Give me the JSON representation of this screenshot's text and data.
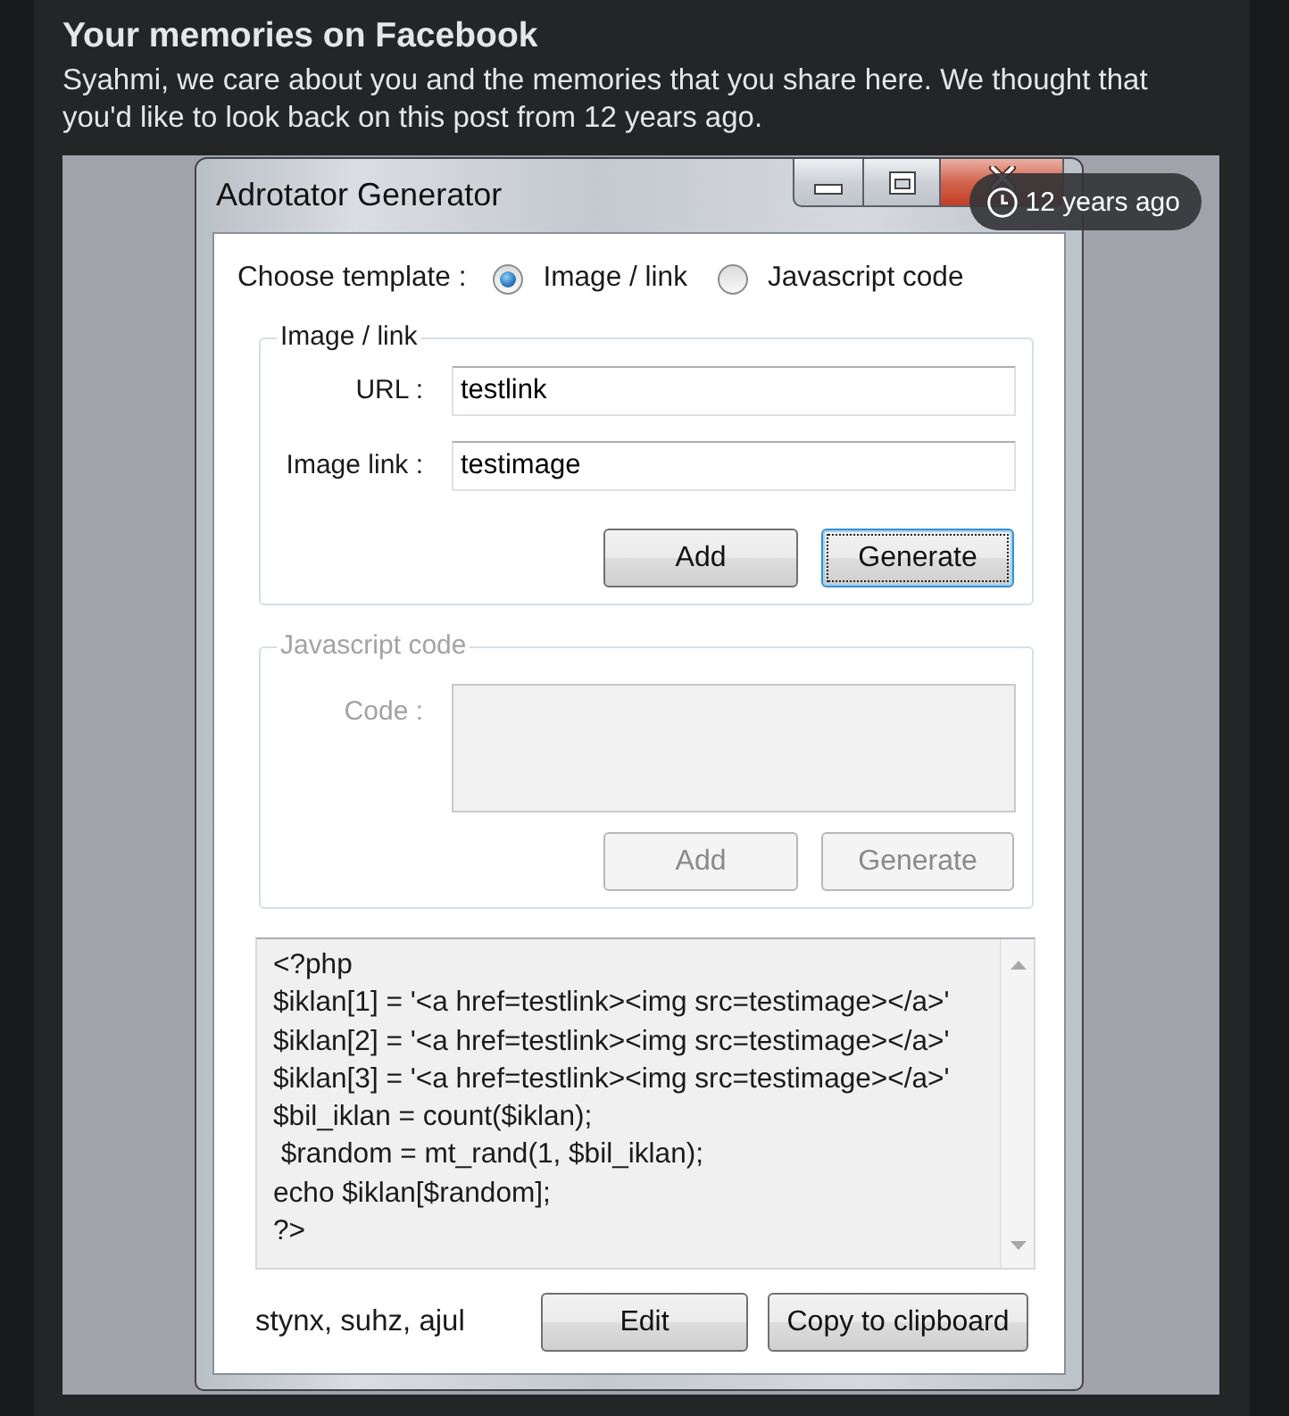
{
  "memory": {
    "title": "Your memories on Facebook",
    "message": "Syahmi, we care about you and the memories that you share here. We thought that you'd like to look back on this post from 12 years ago."
  },
  "post": {
    "badge": "12 years ago",
    "window": {
      "title": "Adrotator Generator",
      "template": {
        "label": "Choose template :",
        "options": [
          {
            "label": "Image / link",
            "selected": true
          },
          {
            "label": "Javascript code",
            "selected": false
          }
        ]
      },
      "groups": [
        {
          "legend": "Image / link",
          "disabled": false,
          "fields": [
            {
              "kind": "line",
              "label": "URL :",
              "value": "testlink"
            },
            {
              "kind": "line",
              "label": "Image link :",
              "value": "testimage"
            }
          ],
          "buttons": [
            {
              "label": "Add",
              "focused": false
            },
            {
              "label": "Generate",
              "focused": true
            }
          ]
        },
        {
          "legend": "Javascript code",
          "disabled": true,
          "fields": [
            {
              "kind": "multiline",
              "label": "Code :"
            }
          ],
          "buttons": [
            {
              "label": "Add"
            },
            {
              "label": "Generate"
            }
          ]
        }
      ],
      "output": {
        "lines": [
          "<?php",
          "$iklan[1] = '<a href=testlink><img src=testimage></a>'",
          "$iklan[2] = '<a href=testlink><img src=testimage></a>'",
          "$iklan[3] = '<a href=testlink><img src=testimage></a>'",
          "$bil_iklan = count($iklan);",
          " $random = mt_rand(1, $bil_iklan);",
          "echo $iklan[$random];",
          "?>"
        ]
      },
      "footer": {
        "credits": "stynx, suhz, ajul",
        "buttons": [
          "Edit",
          "Copy to clipboard"
        ]
      }
    }
  }
}
